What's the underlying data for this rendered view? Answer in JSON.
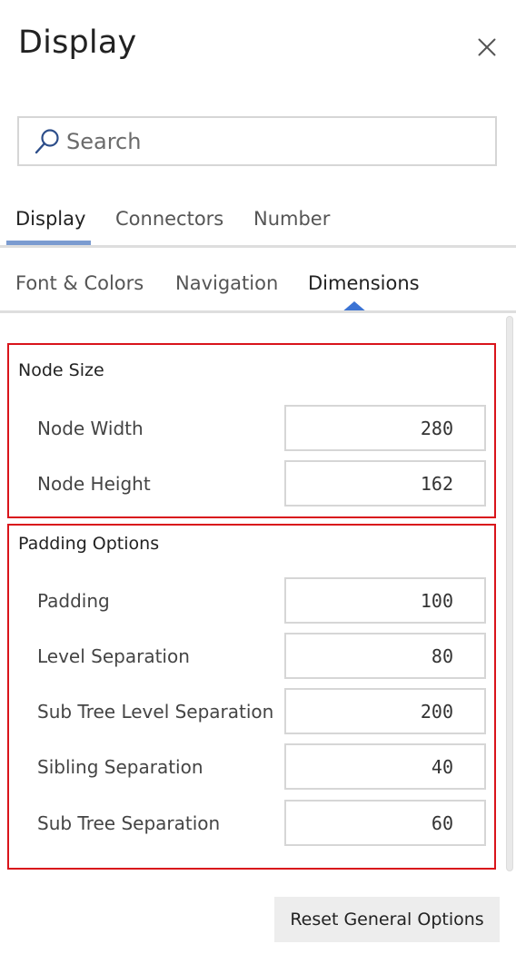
{
  "panel": {
    "title": "Display"
  },
  "search": {
    "placeholder": "Search",
    "value": ""
  },
  "primary_tabs": [
    {
      "label": "Display",
      "active": true
    },
    {
      "label": "Connectors",
      "active": false
    },
    {
      "label": "Number",
      "active": false
    }
  ],
  "secondary_tabs": [
    {
      "label": "Font & Colors",
      "active": false
    },
    {
      "label": "Navigation",
      "active": false
    },
    {
      "label": "Dimensions",
      "active": true
    }
  ],
  "node_size": {
    "title": "Node Size",
    "fields": [
      {
        "label": "Node Width",
        "value": "280"
      },
      {
        "label": "Node Height",
        "value": "162"
      }
    ]
  },
  "padding_options": {
    "title": "Padding Options",
    "fields": [
      {
        "label": "Padding",
        "value": "100"
      },
      {
        "label": "Level Separation",
        "value": "80"
      },
      {
        "label": "Sub Tree Level Separation",
        "value": "200"
      },
      {
        "label": "Sibling Separation",
        "value": "40"
      },
      {
        "label": "Sub Tree Separation",
        "value": "60"
      }
    ]
  },
  "footer": {
    "reset_label": "Reset General Options"
  },
  "colors": {
    "accent": "#3b73d4",
    "tab_underline": "#7b9bd0",
    "highlight_border": "#d9141b"
  },
  "icons": {
    "close": "close-icon",
    "search": "search-icon"
  }
}
